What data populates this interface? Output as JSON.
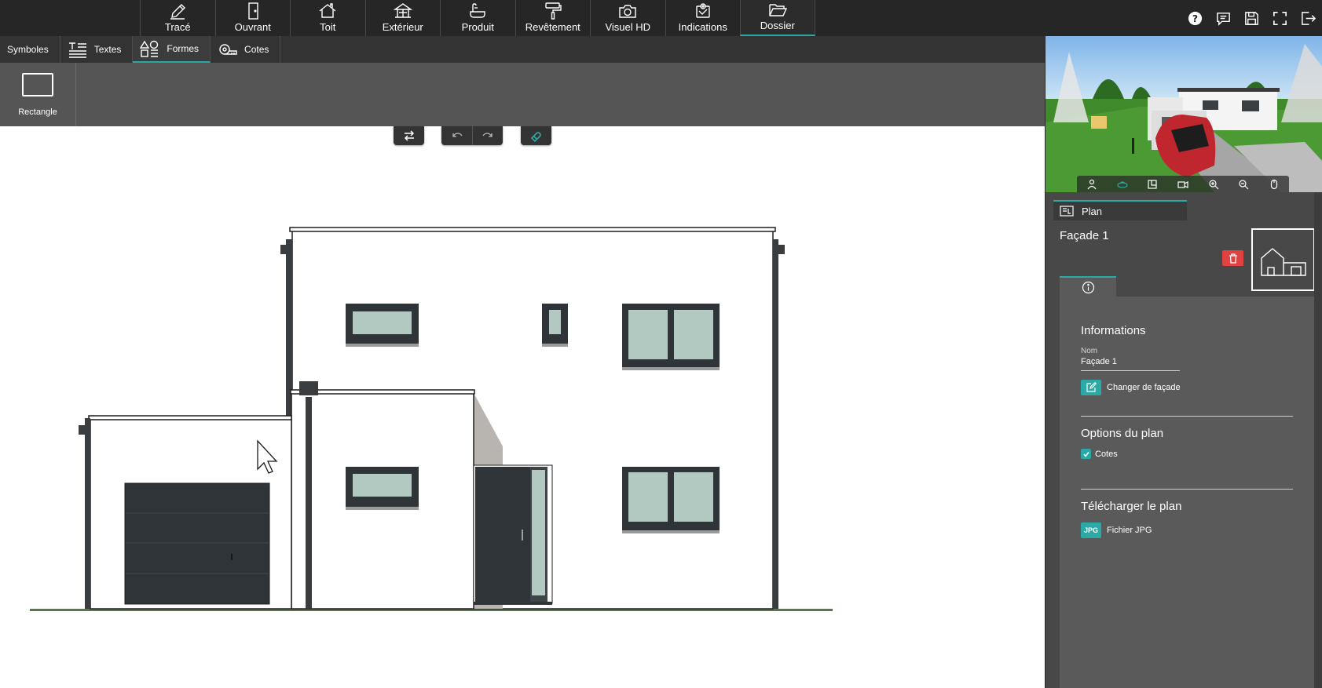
{
  "topnav": {
    "items": [
      {
        "label": "Tracé",
        "icon": "pencil-icon"
      },
      {
        "label": "Ouvrant",
        "icon": "door-icon"
      },
      {
        "label": "Toit",
        "icon": "roof-icon"
      },
      {
        "label": "Extérieur",
        "icon": "gazebo-icon"
      },
      {
        "label": "Produit",
        "icon": "bathtub-icon"
      },
      {
        "label": "Revêtement",
        "icon": "paint-roller-icon"
      },
      {
        "label": "Visuel HD",
        "icon": "camera-icon"
      },
      {
        "label": "Indications",
        "icon": "annotation-icon"
      },
      {
        "label": "Dossier",
        "icon": "folder-icon"
      }
    ],
    "active": "Dossier",
    "right_icons": [
      "help-icon",
      "comment-icon",
      "save-icon",
      "fullscreen-icon",
      "logout-icon"
    ]
  },
  "subbar": {
    "tabs": [
      {
        "label": "Symboles"
      },
      {
        "label": "Textes"
      },
      {
        "label": "Formes"
      },
      {
        "label": "Cotes"
      }
    ],
    "active": "Formes"
  },
  "ribbon": {
    "shape_label": "Rectangle"
  },
  "canvas_tools": [
    "swap-icon",
    "undo-icon",
    "redo-icon",
    "magnet-icon"
  ],
  "right_panel": {
    "tab_label": "Plan",
    "title": "Façade 1",
    "informations": {
      "heading": "Informations",
      "name_label": "Nom",
      "name_value": "Façade 1",
      "change_label": "Changer de façade"
    },
    "options": {
      "heading": "Options du plan",
      "cotes_label": "Cotes",
      "cotes_checked": true
    },
    "download": {
      "heading": "Télécharger le plan",
      "badge": "JPG",
      "file_label": "Fichier JPG"
    }
  },
  "colors": {
    "accent": "#2aa9a6",
    "toolbar": "#262626",
    "panel": "#484848",
    "delete": "#e04141",
    "glass": "#b2c9c2",
    "frame": "#2f3438"
  }
}
